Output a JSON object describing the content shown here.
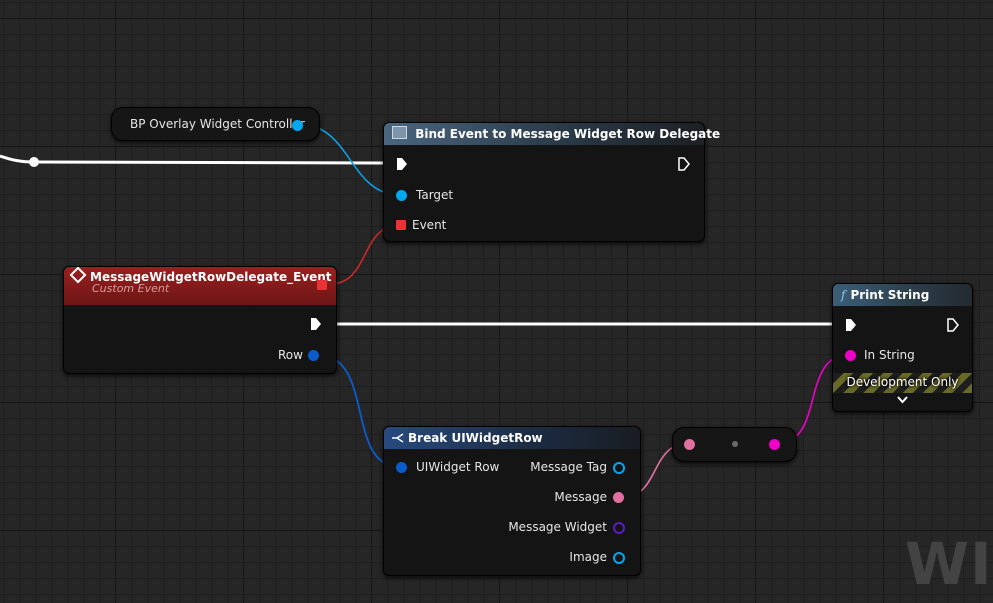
{
  "nodes": {
    "bp_overlay": {
      "pin_label": "BP Overlay Widget Controller"
    },
    "bind_event": {
      "title": "Bind Event to Message Widget Row Delegate",
      "pins": {
        "target": "Target",
        "event": "Event"
      }
    },
    "custom_event": {
      "title": "MessageWidgetRowDelegate_Event",
      "subtitle": "Custom Event",
      "pins": {
        "row": "Row"
      }
    },
    "break_row": {
      "title": "Break UIWidgetRow",
      "pins": {
        "input": "UIWidget Row",
        "message_tag": "Message Tag",
        "message": "Message",
        "message_widget": "Message Widget",
        "image": "Image"
      }
    },
    "print_string": {
      "title": "Print String",
      "pins": {
        "in_string": "In String"
      },
      "dev_only": "Development Only"
    }
  },
  "watermark": "WID",
  "colors": {
    "exec": "#ffffff",
    "object_pin": "#00a8f0",
    "delegate_pin": "#e83434",
    "struct_pin": "#0a5ccc",
    "text_pin": "#e070a0",
    "string_pin": "#f000c8",
    "purple_pin": "#5a1dc4"
  },
  "icons": {
    "bind_node": "function-box-icon",
    "event_node": "event-diamond-icon",
    "break_node": "break-struct-icon",
    "print_node": "function-f-icon",
    "expand": "chevron-down-icon"
  }
}
